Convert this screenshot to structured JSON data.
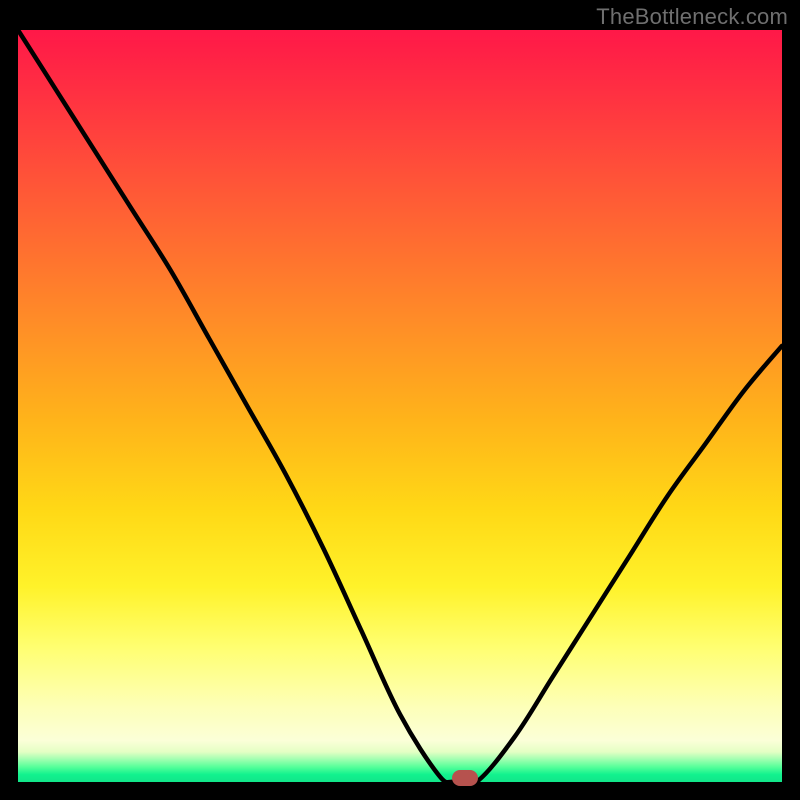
{
  "attribution": "TheBottleneck.com",
  "colors": {
    "background": "#000000",
    "curve": "#000000",
    "marker": "#b6524e",
    "attribution_text": "#6f6f6f"
  },
  "chart_data": {
    "type": "line",
    "title": "",
    "xlabel": "",
    "ylabel": "",
    "xlim": [
      0,
      100
    ],
    "ylim": [
      0,
      100
    ],
    "series": [
      {
        "name": "bottleneck-curve",
        "x": [
          0,
          5,
          10,
          15,
          20,
          25,
          30,
          35,
          40,
          45,
          50,
          55,
          57,
          60,
          65,
          70,
          75,
          80,
          85,
          90,
          95,
          100
        ],
        "values": [
          100,
          92,
          84,
          76,
          68,
          59,
          50,
          41,
          31,
          20,
          9,
          1,
          0,
          0,
          6,
          14,
          22,
          30,
          38,
          45,
          52,
          58
        ]
      }
    ],
    "annotations": [
      {
        "name": "optimal-point-marker",
        "x": 58.5,
        "y": 0.5
      }
    ],
    "grid": false,
    "legend": false
  }
}
